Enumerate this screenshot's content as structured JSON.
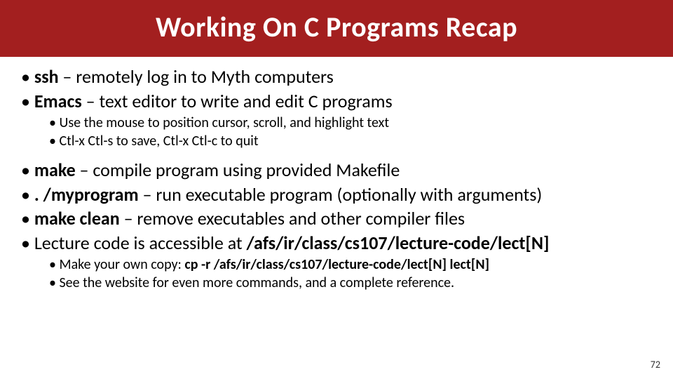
{
  "title": "Working On C Programs Recap",
  "page_number": "72",
  "b1_cmd": "ssh",
  "b1_desc": " – remotely log in to Myth computers",
  "b2_cmd": "Emacs",
  "b2_desc": " – text editor to write and edit C programs",
  "b2_sub1": "Use the mouse to position cursor, scroll, and highlight text",
  "b2_sub2": "Ctl-x Ctl-s to save, Ctl-x Ctl-c to quit",
  "b3_cmd": "make",
  "b3_desc": " – compile program using provided Makefile",
  "b4_cmd": ". /myprogram",
  "b4_desc": " – run executable program (optionally with arguments)",
  "b5_cmd": "make clean",
  "b5_desc": " – remove executables and other compiler files",
  "b6_pre": "Lecture code is accessible at ",
  "b6_path": "/afs/ir/class/cs107/lecture-code/lect[N]",
  "b6_sub1_pre": "Make your own copy: ",
  "b6_sub1_cmd": "cp -r /afs/ir/class/cs107/lecture-code/lect[N] lect[N]",
  "b6_sub2": "See the website for even more commands, and a complete reference."
}
